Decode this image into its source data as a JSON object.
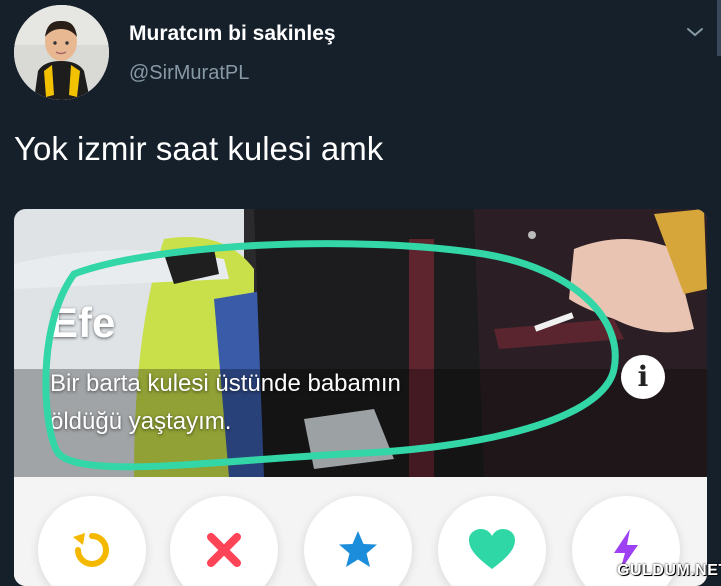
{
  "tweet": {
    "author": {
      "display_name": "Muratcım bi sakinleş",
      "handle": "@SirMuratPL",
      "avatar_icon": "child-avatar"
    },
    "text": "Yok izmir saat kulesi amk",
    "menu_icon": "chevron-down-icon"
  },
  "media": {
    "profile_card": {
      "name": "Efe",
      "bio_line1": "Bir barta kulesi üstünde babamın",
      "bio_line2": "öldüğü yaştayım.",
      "info_label": "i"
    },
    "annotation_color": "#33d6a6",
    "action_buttons": [
      {
        "name": "rewind",
        "icon": "rewind-icon",
        "color": "#f5b800"
      },
      {
        "name": "nope",
        "icon": "x-icon",
        "color": "#ff4458"
      },
      {
        "name": "super-like",
        "icon": "star-icon",
        "color": "#1c8ddb"
      },
      {
        "name": "like",
        "icon": "heart-icon",
        "color": "#2fd6a6"
      },
      {
        "name": "boost",
        "icon": "bolt-icon",
        "color": "#9d3ff2"
      }
    ]
  },
  "watermark": "GULDUM.NET"
}
